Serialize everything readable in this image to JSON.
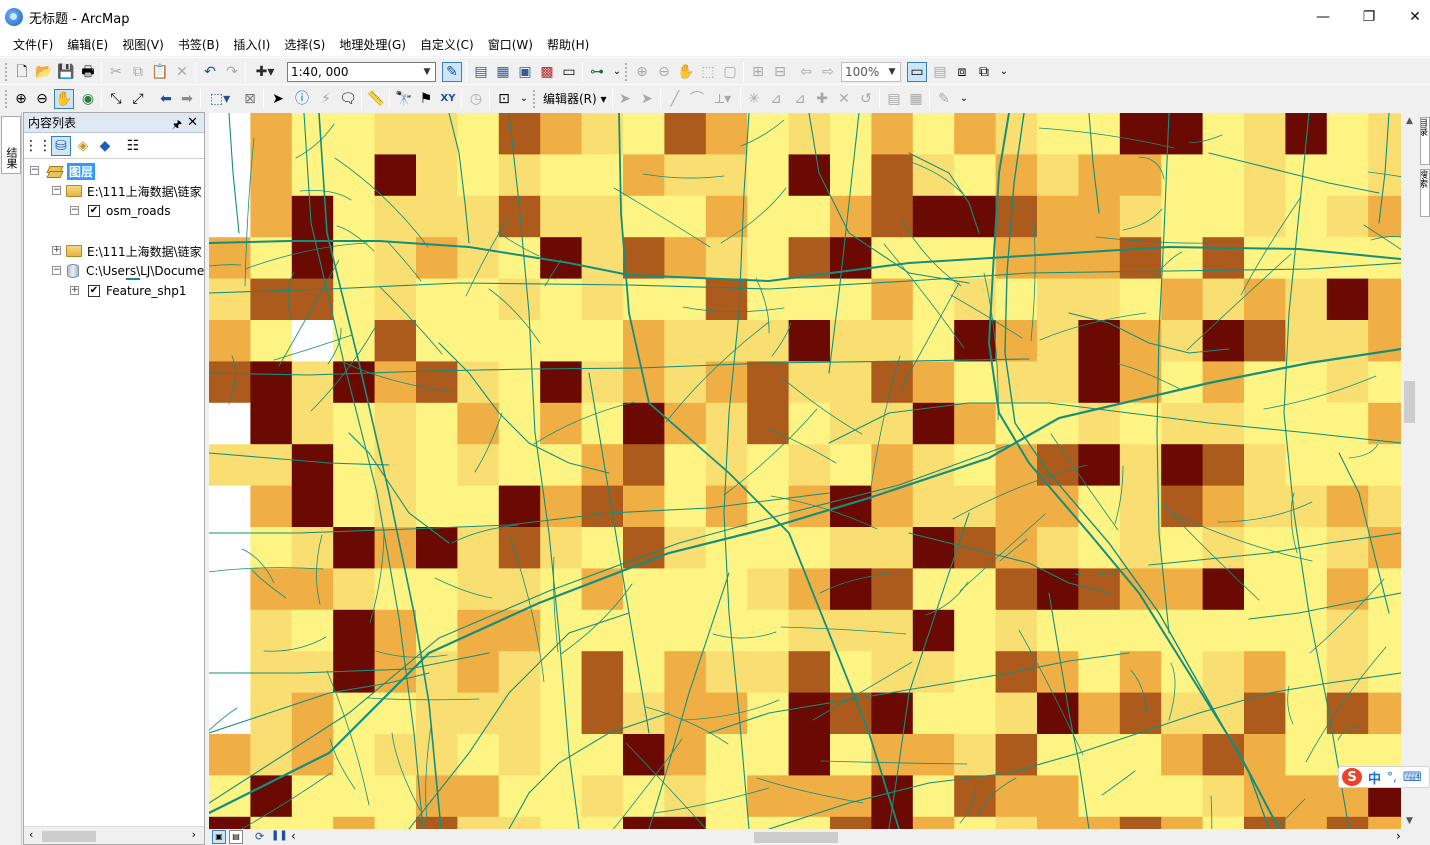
{
  "window": {
    "title": "无标题 - ArcMap",
    "minimize": "—",
    "maximize": "❐",
    "close": "✕"
  },
  "menu": [
    "文件(F)",
    "编辑(E)",
    "视图(V)",
    "书签(B)",
    "插入(I)",
    "选择(S)",
    "地理处理(G)",
    "自定义(C)",
    "窗口(W)",
    "帮助(H)"
  ],
  "toolbar": {
    "scale_value": "1:40, 000",
    "zoom_value": "100%",
    "editor_label": "编辑器(R)"
  },
  "left_tab": "结果",
  "toc": {
    "title": "内容列表",
    "pin": "🖈",
    "close": "✕",
    "layers_label": "图层",
    "items": [
      {
        "label": "E:\\111上海数据\\链家",
        "type": "folder",
        "expanded": true
      },
      {
        "label": "osm_roads",
        "type": "layer",
        "checked": true,
        "expanded": true
      },
      {
        "label": "E:\\111上海数据\\链家",
        "type": "folder",
        "expanded": false
      },
      {
        "label": "C:\\Users\\LJ\\Docume",
        "type": "database",
        "expanded": true
      },
      {
        "label": "Feature_shp1",
        "type": "layer",
        "checked": true,
        "expanded": false
      }
    ]
  },
  "right_tabs": [
    "目录",
    "搜索"
  ],
  "ime": {
    "logo": "S",
    "mode": "中",
    "punct": "°,",
    "keyboard": "⌨"
  },
  "colors": {
    "road": "#138f7b",
    "class_1": "#fdf483",
    "class_2": "#f9df72",
    "class_3": "#f0af45",
    "class_4": "#ad5a1d",
    "class_5": "#6a0a02",
    "nodata": "#ffffff"
  }
}
